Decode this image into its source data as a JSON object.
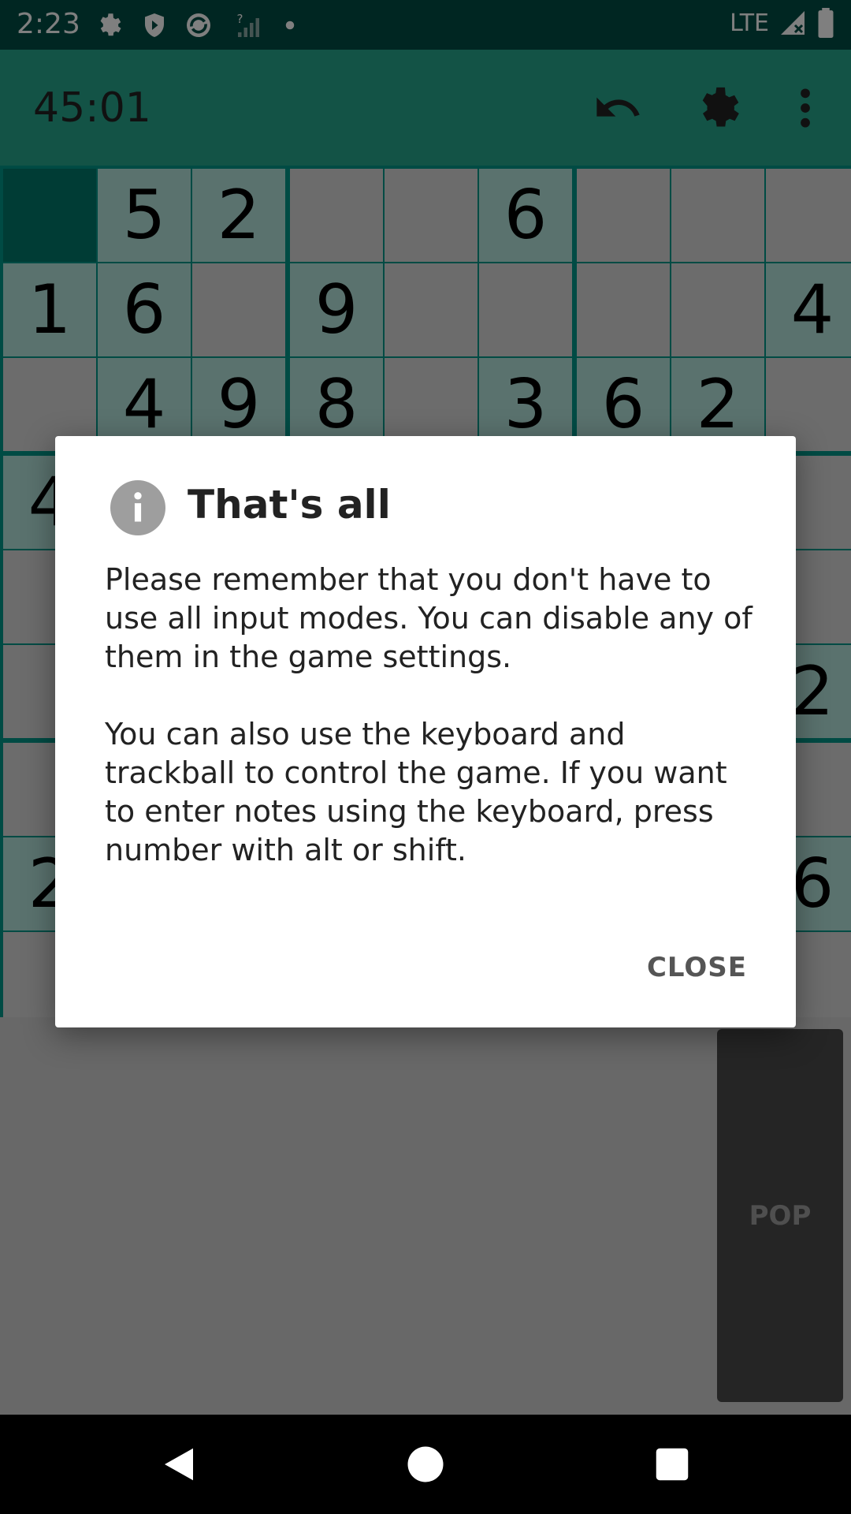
{
  "status_bar": {
    "time": "2:23",
    "network": "LTE",
    "icons": [
      "settings-icon",
      "shield-icon",
      "sync-icon",
      "no-signal-icon",
      "notification-dot-icon",
      "signal-icon",
      "battery-icon"
    ]
  },
  "toolbar": {
    "timer": "45:01",
    "icons": [
      "undo-icon",
      "settings-icon",
      "more-vert-icon"
    ]
  },
  "board": {
    "selected_cell": [
      0,
      0
    ],
    "rows": [
      [
        "",
        "5",
        "2",
        "",
        "",
        "6",
        "",
        "",
        ""
      ],
      [
        "1",
        "6",
        "",
        "9",
        "",
        "",
        "",
        "",
        "4"
      ],
      [
        "",
        "4",
        "9",
        "8",
        "",
        "3",
        "6",
        "2",
        ""
      ],
      [
        "4",
        "",
        "",
        "",
        "",
        "",
        "",
        "",
        ""
      ],
      [
        "",
        "",
        "",
        "",
        "",
        "",
        "",
        "",
        ""
      ],
      [
        "",
        "",
        "",
        "",
        "",
        "",
        "",
        "",
        "2"
      ],
      [
        "",
        "",
        "",
        "",
        "",
        "",
        "",
        "",
        ""
      ],
      [
        "2",
        "",
        "",
        "",
        "",
        "",
        "",
        "",
        "6"
      ],
      [
        "",
        "",
        "",
        "",
        "",
        "",
        "",
        "",
        ""
      ]
    ]
  },
  "side_panel": {
    "label": "POP"
  },
  "dialog": {
    "icon": "info-icon",
    "title": "That's all",
    "paragraph1": "Please remember that you don't have to use all input modes. You can disable any of them in the game settings.",
    "paragraph2": "You can also use the keyboard and trackball to control the game. If you want to enter notes using the keyboard, press number with alt or shift.",
    "close_label": "CLOSE"
  },
  "nav": {
    "icons": [
      "back-icon",
      "home-icon",
      "recents-icon"
    ]
  }
}
